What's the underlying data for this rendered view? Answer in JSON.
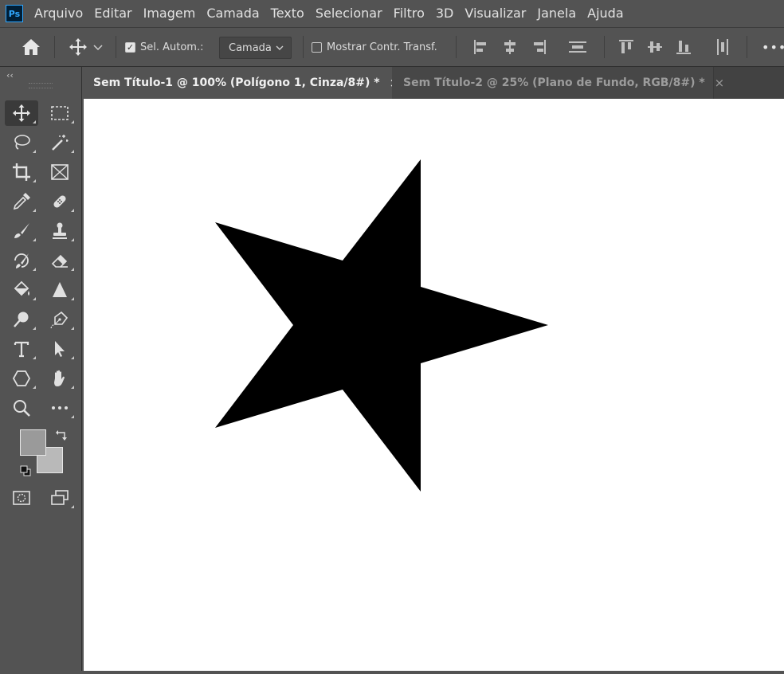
{
  "app": {
    "logo_text": "Ps",
    "menu": [
      "Arquivo",
      "Editar",
      "Imagem",
      "Camada",
      "Texto",
      "Selecionar",
      "Filtro",
      "3D",
      "Visualizar",
      "Janela",
      "Ajuda"
    ]
  },
  "options_bar": {
    "auto_select_label": "Sel. Autom.:",
    "auto_select_checked": true,
    "auto_select_target": "Camada",
    "show_transform_label": "Mostrar Contr. Transf.",
    "show_transform_checked": false,
    "more_label": "•••"
  },
  "tabs": [
    {
      "label": "Sem Título-1 @ 100% (Polígono 1, Cinza/8#) *",
      "active": true,
      "close": "×"
    },
    {
      "label": "Sem Título-2 @ 25% (Plano de Fundo, RGB/8#) *",
      "active": false,
      "close": "×"
    }
  ],
  "tools": [
    {
      "name": "move-tool-icon",
      "active": true
    },
    {
      "name": "rect-marquee-tool-icon"
    },
    {
      "name": "lasso-tool-icon"
    },
    {
      "name": "magic-wand-tool-icon"
    },
    {
      "name": "crop-tool-icon"
    },
    {
      "name": "frame-tool-icon"
    },
    {
      "name": "eyedropper-tool-icon"
    },
    {
      "name": "healing-brush-tool-icon"
    },
    {
      "name": "brush-tool-icon"
    },
    {
      "name": "clone-stamp-tool-icon"
    },
    {
      "name": "history-brush-tool-icon"
    },
    {
      "name": "eraser-tool-icon"
    },
    {
      "name": "paint-bucket-tool-icon"
    },
    {
      "name": "blur-tool-icon"
    },
    {
      "name": "dodge-tool-icon"
    },
    {
      "name": "pen-tool-icon"
    },
    {
      "name": "type-tool-icon"
    },
    {
      "name": "path-selection-tool-icon"
    },
    {
      "name": "shape-tool-icon"
    },
    {
      "name": "hand-tool-icon"
    },
    {
      "name": "zoom-tool-icon"
    },
    {
      "name": "more-tools-icon"
    }
  ],
  "colors": {
    "foreground": "#9a9a9a",
    "background": "#b9b9b9",
    "canvas": "#ffffff",
    "shape_fill": "#000000"
  },
  "canvas": {
    "shape": "star-5-point"
  }
}
